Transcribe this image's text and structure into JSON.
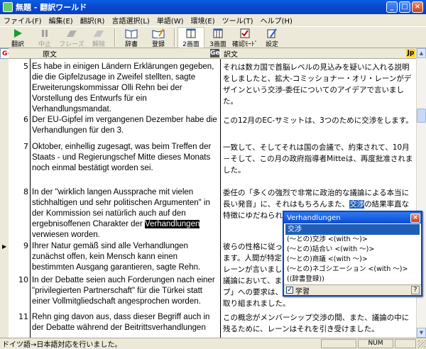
{
  "window": {
    "title": "無題 - 翻訳ワールド"
  },
  "menu": [
    "ファイル(F)",
    "編集(E)",
    "翻訳(R)",
    "言語選択(L)",
    "単語(W)",
    "環境(E)",
    "ツール(T)",
    "ヘルプ(H)"
  ],
  "toolbar": [
    {
      "label": "翻訳",
      "icon": "play-icon",
      "disabled": false
    },
    {
      "label": "中止",
      "icon": "pause-icon",
      "disabled": true
    },
    {
      "label": "フレーズ",
      "icon": "phrase-icon",
      "disabled": true
    },
    {
      "label": "解除",
      "icon": "release-icon",
      "disabled": true
    },
    {
      "label": "辞書",
      "icon": "book-icon",
      "disabled": false
    },
    {
      "label": "登録",
      "icon": "register-icon",
      "disabled": false
    },
    {
      "label": "2画面",
      "icon": "two-pane-icon",
      "disabled": false
    },
    {
      "label": "3画面",
      "icon": "three-pane-icon",
      "disabled": false
    },
    {
      "label": "確認ﾓｰﾄﾞ",
      "icon": "check-mode-icon",
      "disabled": false
    },
    {
      "label": "設定",
      "icon": "settings-icon",
      "disabled": false
    }
  ],
  "columns": {
    "lang_selector": "G→J",
    "source_header": "原文",
    "target_header": "訳文",
    "source_badge": "Ge",
    "target_badge": "Jp"
  },
  "segments": [
    {
      "num": "5",
      "source": "Es habe in einigen Ländern Erklärungen gegeben, die die Gipfelzusage in Zweifel stellten, sagte Erweiterungskommissar Olli Rehn bei der Vorstellung des Entwurfs für ein Verhandlungsmandat.",
      "target": "それは数カ国で首脳レベルの見込みを疑いに入れる説明をしましたと、拡大-コミッショナー・オリ・レーンがデザインという交渉-委任についてのアイデアで言いました。"
    },
    {
      "num": "6",
      "source": "Der EU-Gipfel im vergangenen Dezember habe die Verhandlungen für den 3.",
      "target": "この12月のEC-サミットは、3つのために交渉をします。"
    },
    {
      "num": "7",
      "source": "Oktober, einhellig zugesagt, was beim Treffen der Staats - und Regierungschef Mitte dieses Monats noch einmal bestätigt worden sei.",
      "target": "一致して、そしてそれは国の会議で、約束されて、10月－そして、この月の政府指導者Mitteは、再度批准されました。"
    },
    {
      "num": "8",
      "source_before": "In der \"wirklich langen Aussprache mit vielen stichhaltigen und sehr politischen Argumenten\" in der Kommission sei natürlich auch auf den ergebnisoffenen Charakter der ",
      "source_highlight": "Verhandlungen",
      "source_after": " verwiesen worden.",
      "target_before": "委任の「多くの強烈で非常に政治的な議論による本当に長い発音」に、それはもちろんまた、",
      "target_highlight": "交渉",
      "target_after": "の結果率直な特徴にゆだねられました。"
    },
    {
      "num": "9",
      "source": "Ihrer Natur gemäß sind alle Verhandlungen zunächst offen, kein Mensch kann einen bestimmten Ausgang garantieren, sagte Rehn.",
      "target": "彼らの性格に従って、すべての交渉は最初に、開いています。人間が特定の出口を保証することができないと、レーンが言いました。"
    },
    {
      "num": "10",
      "source": "In der Debatte seien auch Forderungen nach einer \"privilegierten Partnerschaft\" für die Türkei statt einer Vollmitgliedschaft angesprochen worden.",
      "target": "議論において、また「特権を与えられたパートナーシップ」への要求は、完全な会員の代わりにトルコのために取り組まれました。"
    },
    {
      "num": "11",
      "source": "Rehn ging davon aus, dass dieser Begriff auch in der Debatte während der Beitrittsverhandlungen",
      "target": "この概念がメンバーシップ交渉の間、また、議論の中に残るために、レーンはそれを引き受けました。"
    }
  ],
  "popup": {
    "title": "Verhandlungen",
    "headword": "交渉",
    "entries": [
      "(～との)交渉 <(with ～)>",
      "(～との)話合い <(with ～)>",
      "(～との)商議 <(with ～)>",
      "(～との)ネゴシエーション <(with ～)>",
      "((辞書登録))"
    ],
    "learn_label": "学習",
    "learn_checked": "✓",
    "help": "?"
  },
  "status": {
    "text": "ドイツ語→日本語対応を行いました。",
    "num_indicator": "NUM"
  }
}
